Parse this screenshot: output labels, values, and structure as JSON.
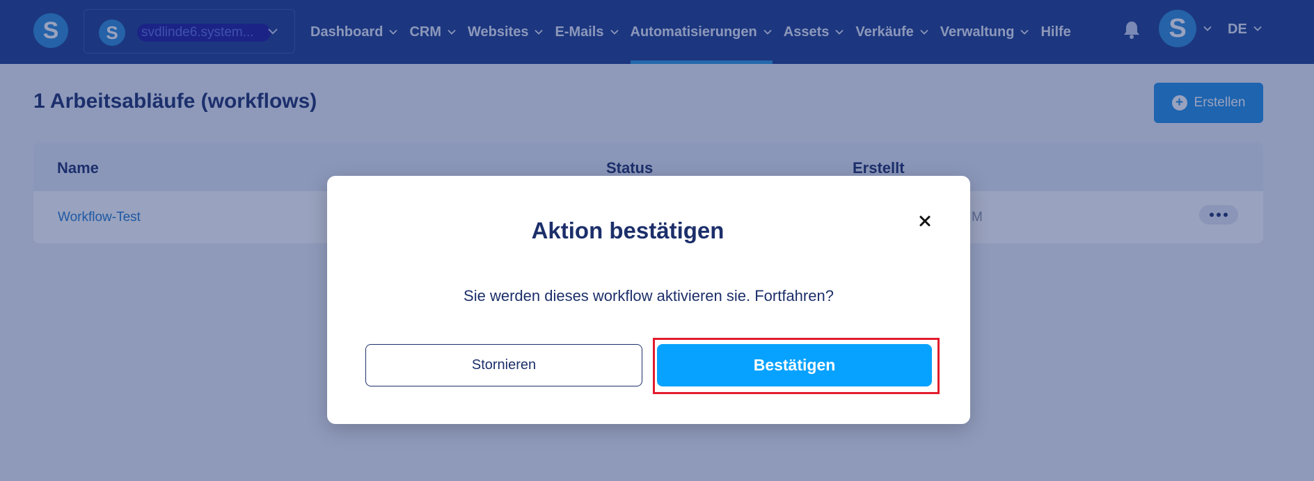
{
  "colors": {
    "nav_bg": "#1c3c8c",
    "accent": "#1f8ee3",
    "confirm_button": "#07a2ff",
    "highlight_border": "#e21b2d",
    "title_text": "#1c2f6a"
  },
  "header": {
    "logo_letter": "S",
    "account": {
      "avatar_letter": "S",
      "name": "svdlinde6.system..."
    },
    "nav_items": [
      {
        "label": "Dashboard",
        "has_dropdown": true
      },
      {
        "label": "CRM",
        "has_dropdown": true
      },
      {
        "label": "Websites",
        "has_dropdown": true
      },
      {
        "label": "E-Mails",
        "has_dropdown": true
      },
      {
        "label": "Automatisierungen",
        "has_dropdown": true,
        "active": true
      },
      {
        "label": "Assets",
        "has_dropdown": true
      },
      {
        "label": "Verkäufe",
        "has_dropdown": true
      },
      {
        "label": "Verwaltung",
        "has_dropdown": true
      },
      {
        "label": "Hilfe",
        "has_dropdown": false
      }
    ],
    "notification_icon": "bell-icon",
    "user_avatar_letter": "S",
    "language": "DE"
  },
  "page": {
    "title": "1 Arbeitsabläufe (workflows)",
    "create_button_label": "Erstellen",
    "table": {
      "columns": [
        "Name",
        "Status",
        "Erstellt"
      ],
      "rows": [
        {
          "name": "Workflow-Test",
          "created_partial": "M"
        }
      ]
    }
  },
  "modal": {
    "title": "Aktion bestätigen",
    "message": "Sie werden dieses workflow aktivieren sie. Fortfahren?",
    "cancel_label": "Stornieren",
    "confirm_label": "Bestätigen"
  }
}
